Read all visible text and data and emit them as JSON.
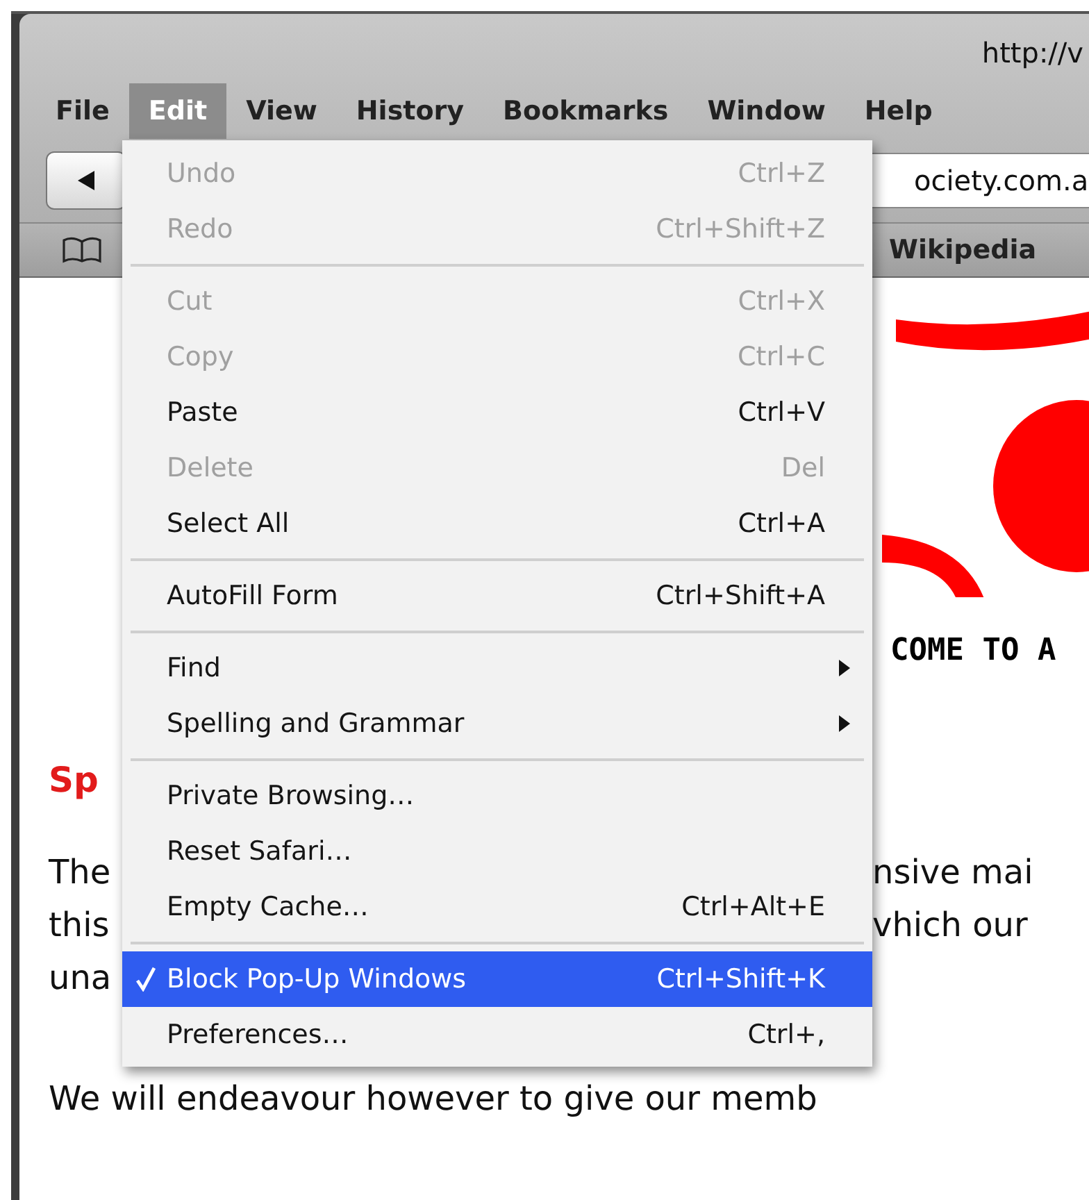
{
  "window": {
    "title": "http://v"
  },
  "menu_bar": [
    {
      "label": "File",
      "selected": false
    },
    {
      "label": "Edit",
      "selected": true
    },
    {
      "label": "View",
      "selected": false
    },
    {
      "label": "History",
      "selected": false
    },
    {
      "label": "Bookmarks",
      "selected": false
    },
    {
      "label": "Window",
      "selected": false
    },
    {
      "label": "Help",
      "selected": false
    }
  ],
  "address_bar": {
    "value": "ociety.com.a"
  },
  "bookmarks_bar": {
    "items": [
      "Wikipedia"
    ]
  },
  "page": {
    "banner_heading": "COME TO A",
    "section_heading": "Sp",
    "paragraph_lines": [
      {
        "left": "The",
        "right": "nsive mai"
      },
      {
        "left": "this",
        "right": "vhich our"
      },
      {
        "left": "una"
      }
    ],
    "last_line": "We will endeavour however to give our memb"
  },
  "edit_menu": [
    {
      "kind": "item",
      "label": "Undo",
      "shortcut": "Ctrl+Z",
      "disabled": true,
      "checked": false,
      "selected": false,
      "submenu": false
    },
    {
      "kind": "item",
      "label": "Redo",
      "shortcut": "Ctrl+Shift+Z",
      "disabled": true,
      "checked": false,
      "selected": false,
      "submenu": false
    },
    {
      "kind": "separator"
    },
    {
      "kind": "item",
      "label": "Cut",
      "shortcut": "Ctrl+X",
      "disabled": true,
      "checked": false,
      "selected": false,
      "submenu": false
    },
    {
      "kind": "item",
      "label": "Copy",
      "shortcut": "Ctrl+C",
      "disabled": true,
      "checked": false,
      "selected": false,
      "submenu": false
    },
    {
      "kind": "item",
      "label": "Paste",
      "shortcut": "Ctrl+V",
      "disabled": false,
      "checked": false,
      "selected": false,
      "submenu": false
    },
    {
      "kind": "item",
      "label": "Delete",
      "shortcut": "Del",
      "disabled": true,
      "checked": false,
      "selected": false,
      "submenu": false
    },
    {
      "kind": "item",
      "label": "Select All",
      "shortcut": "Ctrl+A",
      "disabled": false,
      "checked": false,
      "selected": false,
      "submenu": false
    },
    {
      "kind": "separator"
    },
    {
      "kind": "item",
      "label": "AutoFill Form",
      "shortcut": "Ctrl+Shift+A",
      "disabled": false,
      "checked": false,
      "selected": false,
      "submenu": false
    },
    {
      "kind": "separator"
    },
    {
      "kind": "item",
      "label": "Find",
      "disabled": false,
      "checked": false,
      "selected": false,
      "submenu": true
    },
    {
      "kind": "item",
      "label": "Spelling and Grammar",
      "disabled": false,
      "checked": false,
      "selected": false,
      "submenu": true
    },
    {
      "kind": "separator"
    },
    {
      "kind": "item",
      "label": "Private Browsing…",
      "disabled": false,
      "checked": false,
      "selected": false,
      "submenu": false
    },
    {
      "kind": "item",
      "label": "Reset Safari…",
      "disabled": false,
      "checked": false,
      "selected": false,
      "submenu": false
    },
    {
      "kind": "item",
      "label": "Empty Cache…",
      "shortcut": "Ctrl+Alt+E",
      "disabled": false,
      "checked": false,
      "selected": false,
      "submenu": false
    },
    {
      "kind": "separator"
    },
    {
      "kind": "item",
      "label": "Block Pop-Up Windows",
      "shortcut": "Ctrl+Shift+K",
      "disabled": false,
      "checked": true,
      "selected": true,
      "submenu": false
    },
    {
      "kind": "item",
      "label": "Preferences…",
      "shortcut": "Ctrl+,",
      "disabled": false,
      "checked": false,
      "selected": false,
      "submenu": false
    }
  ]
}
